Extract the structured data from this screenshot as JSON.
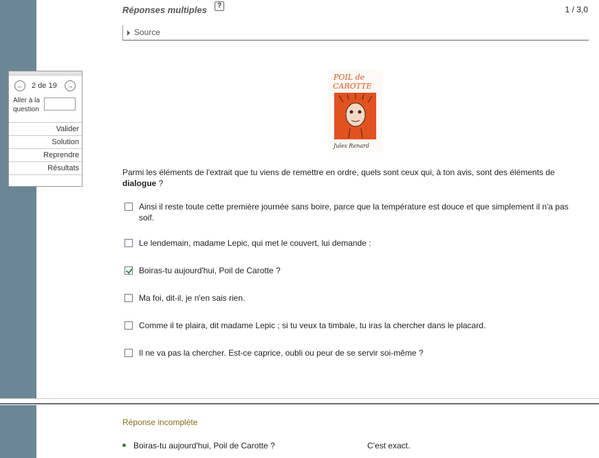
{
  "header": {
    "title": "Réponses multiples",
    "help_label": "?",
    "score": "1 / 3,0"
  },
  "source": {
    "label": "Source"
  },
  "nav": {
    "prev_symbol": "←",
    "next_symbol": "→",
    "counter": "2 de 19",
    "goto_label": "Aller à la question",
    "goto_value": "",
    "buttons": [
      "Valider",
      "Solution",
      "Reprendre",
      "Résultats"
    ]
  },
  "cover": {
    "title_top": "POIL de",
    "title_bottom": "CAROTTE",
    "author": "Jules Renard",
    "colors": {
      "ink": "#e2521f",
      "dark": "#3a2a20"
    }
  },
  "question": {
    "text_before": "Parmi les éléments de l'extrait que tu viens de remettre en ordre, quels sont ceux qui, à ton avis, sont des éléments de ",
    "text_bold": "dialogue",
    "text_after": " ?"
  },
  "options": [
    {
      "text": "Ainsi il reste toute cette première journée sans boire, parce que la température est douce et que simplement il n'a pas soif.",
      "checked": false
    },
    {
      "text": "Le lendemain, madame Lepic, qui met le couvert, lui demande :",
      "checked": false
    },
    {
      "text": "Boiras-tu aujourd'hui, Poil de Carotte ?",
      "checked": true
    },
    {
      "text": "Ma foi, dit-il, je n'en sais rien.",
      "checked": false
    },
    {
      "text": "Comme il te plaira, dit madame Lepic ; si tu veux ta timbale, tu iras la chercher dans le placard.",
      "checked": false
    },
    {
      "text": "Il ne va pas la chercher. Est-ce caprice, oubli ou peur de se servir soi-même ?",
      "checked": false
    }
  ],
  "feedback": {
    "title": "Réponse incomplète",
    "answer": "Boiras-tu aujourd'hui, Poil de Carotte ?",
    "status": "C'est exact."
  },
  "colors": {
    "sidebar": "#6b8795",
    "feedback_title": "#8a6a1a",
    "check": "#3a8a3a"
  }
}
